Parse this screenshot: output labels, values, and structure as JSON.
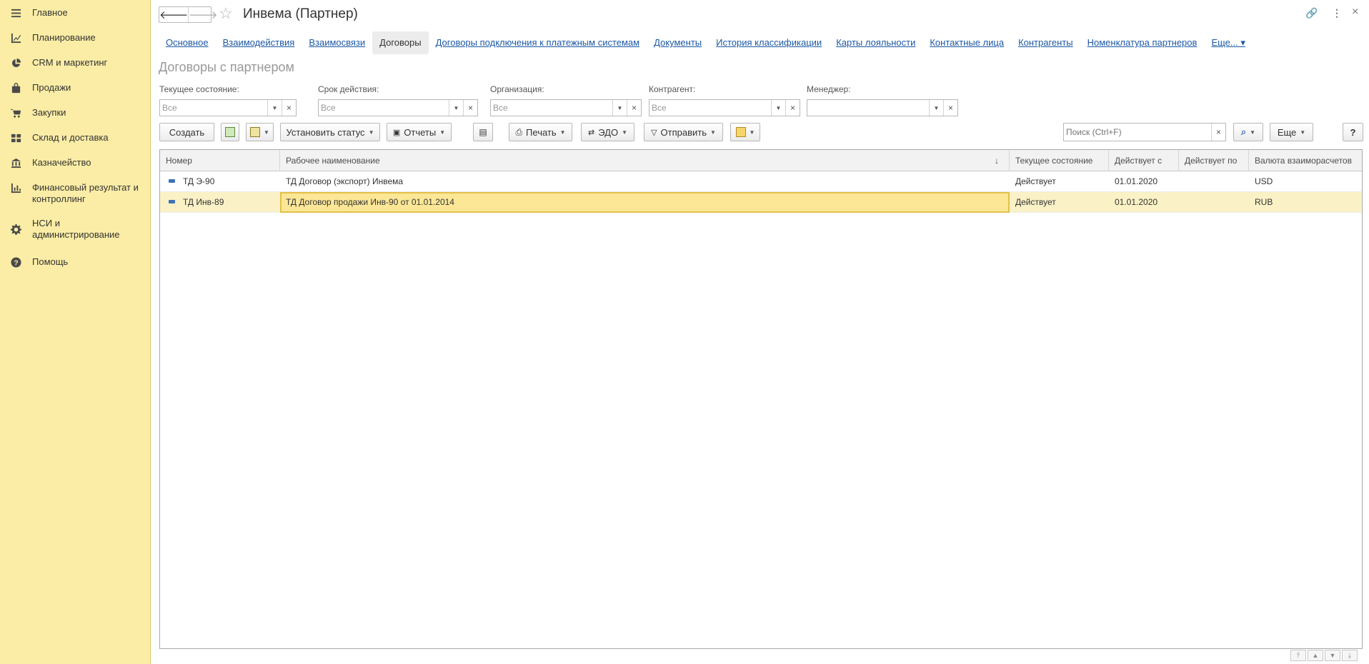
{
  "sidebar": {
    "items": [
      {
        "label": "Главное",
        "icon": "menu-icon"
      },
      {
        "label": "Планирование",
        "icon": "chart-line-icon"
      },
      {
        "label": "CRM и маркетинг",
        "icon": "pie-chart-icon"
      },
      {
        "label": "Продажи",
        "icon": "bag-icon"
      },
      {
        "label": "Закупки",
        "icon": "cart-icon"
      },
      {
        "label": "Склад и доставка",
        "icon": "grid-icon"
      },
      {
        "label": "Казначейство",
        "icon": "bank-icon"
      },
      {
        "label": "Финансовый результат и\nконтроллинг",
        "icon": "bar-chart-icon"
      },
      {
        "label": "НСИ и\nадминистрирование",
        "icon": "gear-icon"
      },
      {
        "label": "Помощь",
        "icon": "help-icon"
      }
    ]
  },
  "header": {
    "title": "Инвема (Партнер)",
    "back": "🡐",
    "forward": "🡒",
    "star": "☆",
    "link_icon": "🔗",
    "more_icon": "⋮",
    "close_icon": "×"
  },
  "tabs": [
    {
      "label": "Основное",
      "active": false
    },
    {
      "label": "Взаимодействия",
      "active": false
    },
    {
      "label": "Взаимосвязи",
      "active": false
    },
    {
      "label": "Договоры",
      "active": true
    },
    {
      "label": "Договоры подключения к платежным системам",
      "active": false
    },
    {
      "label": "Документы",
      "active": false
    },
    {
      "label": "История классификации",
      "active": false
    },
    {
      "label": "Карты лояльности",
      "active": false
    },
    {
      "label": "Контактные лица",
      "active": false
    },
    {
      "label": "Контрагенты",
      "active": false
    },
    {
      "label": "Номенклатура партнеров",
      "active": false
    },
    {
      "label": "Еще... ▾",
      "active": false
    }
  ],
  "subtitle": "Договоры с партнером",
  "filters": {
    "state": {
      "label": "Текущее состояние:",
      "value": "Все"
    },
    "period": {
      "label": "Срок действия:",
      "value": "Все"
    },
    "org": {
      "label": "Организация:",
      "value": "Все"
    },
    "counterparty": {
      "label": "Контрагент:",
      "value": "Все"
    },
    "manager": {
      "label": "Менеджер:",
      "value": ""
    }
  },
  "toolbar": {
    "create": "Создать",
    "set_status": "Установить статус",
    "reports": "Отчеты",
    "print": "Печать",
    "edo": "ЭДО",
    "send": "Отправить",
    "search_placeholder": "Поиск (Ctrl+F)",
    "more": "Еще",
    "help": "?"
  },
  "table": {
    "columns": [
      "Номер",
      "Рабочее наименование",
      "Текущее состояние",
      "Действует с",
      "Действует по",
      "Валюта взаиморасчетов"
    ],
    "sort_indicator": "↓",
    "rows": [
      {
        "number": "ТД Э-90",
        "name": "ТД Договор (экспорт) Инвема",
        "state": "Действует",
        "from": "01.01.2020",
        "to": "",
        "currency": "USD"
      },
      {
        "number": "ТД Инв-89",
        "name": "ТД Договор продажи Инв-90 от 01.01.2014",
        "state": "Действует",
        "from": "01.01.2020",
        "to": "",
        "currency": "RUB"
      }
    ]
  },
  "colors": {
    "sidebar_bg": "#fbeda5",
    "link": "#1c58a3",
    "selected_row": "#faf2c6",
    "focus_cell": "#fce796"
  }
}
